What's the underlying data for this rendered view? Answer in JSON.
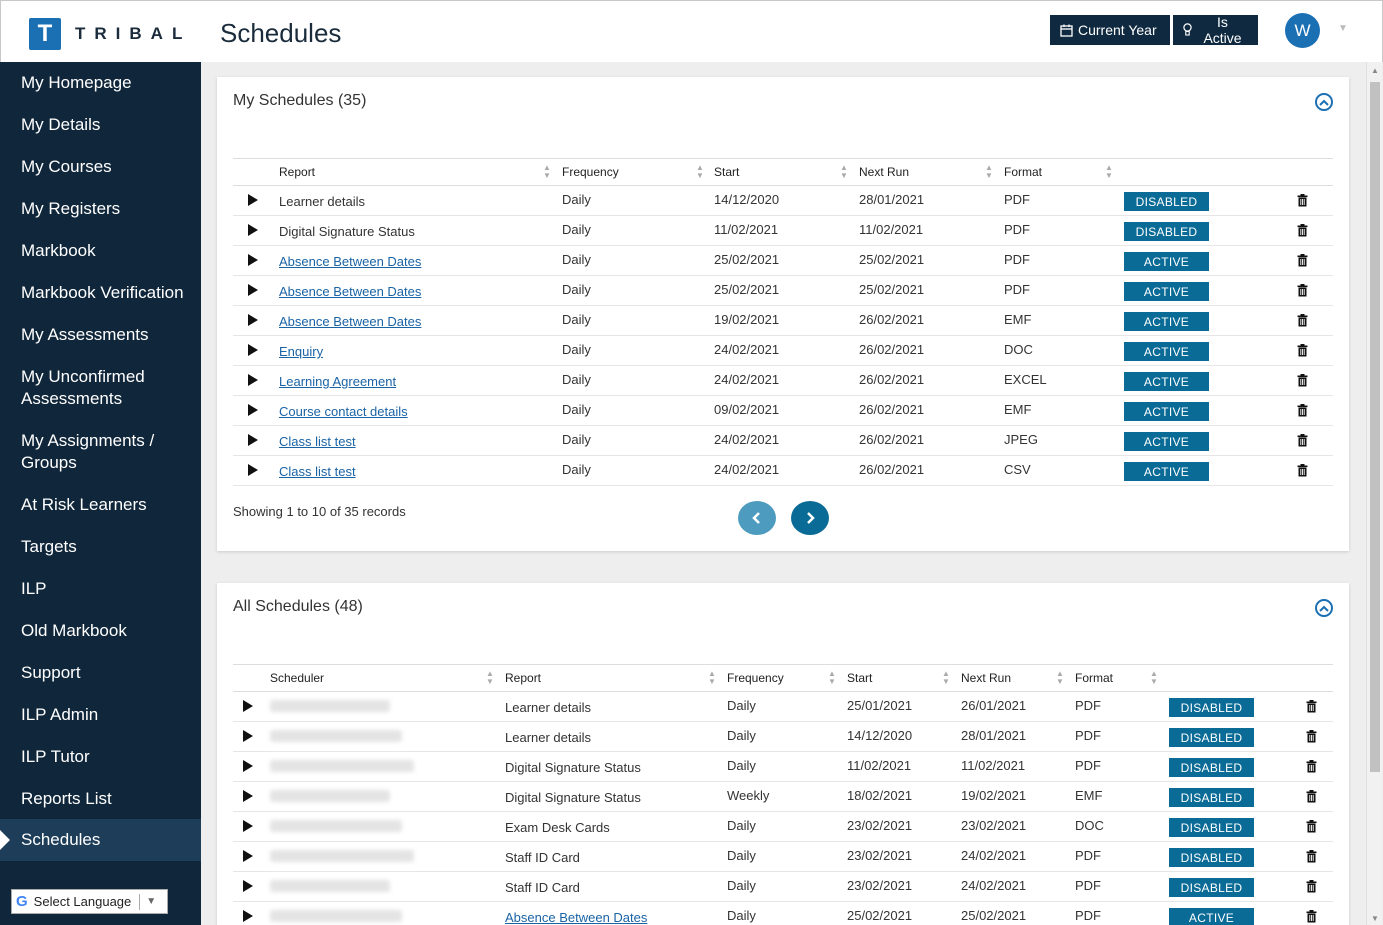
{
  "header": {
    "logo_letter": "T",
    "logo_word": "TRIBAL",
    "page_title": "Schedules",
    "current_year_label": "Current Year",
    "is_active_label": "Is Active",
    "avatar_initial": "W"
  },
  "sidebar": {
    "items": [
      {
        "label": "My Homepage"
      },
      {
        "label": "My Details"
      },
      {
        "label": "My Courses"
      },
      {
        "label": "My Registers"
      },
      {
        "label": "Markbook"
      },
      {
        "label": "Markbook Verification"
      },
      {
        "label": "My Assessments"
      },
      {
        "label": "My Unconfirmed Assessments"
      },
      {
        "label": "My Assignments / Groups"
      },
      {
        "label": "At Risk Learners"
      },
      {
        "label": "Targets"
      },
      {
        "label": "ILP"
      },
      {
        "label": "Old Markbook"
      },
      {
        "label": "Support"
      },
      {
        "label": "ILP Admin"
      },
      {
        "label": "ILP Tutor"
      },
      {
        "label": "Reports List"
      },
      {
        "label": "Schedules",
        "selected": true
      }
    ],
    "language_label": "Select Language"
  },
  "my_schedules": {
    "title": "My Schedules (35)",
    "headers": [
      "Report",
      "Frequency",
      "Start",
      "Next Run",
      "Format"
    ],
    "rows": [
      {
        "report": "Learner details",
        "link": false,
        "frequency": "Daily",
        "start": "14/12/2020",
        "next_run": "28/01/2021",
        "format": "PDF",
        "status": "DISABLED"
      },
      {
        "report": "Digital Signature Status",
        "link": false,
        "frequency": "Daily",
        "start": "11/02/2021",
        "next_run": "11/02/2021",
        "format": "PDF",
        "status": "DISABLED"
      },
      {
        "report": "Absence Between Dates",
        "link": true,
        "frequency": "Daily",
        "start": "25/02/2021",
        "next_run": "25/02/2021",
        "format": "PDF",
        "status": "ACTIVE"
      },
      {
        "report": "Absence Between Dates",
        "link": true,
        "frequency": "Daily",
        "start": "25/02/2021",
        "next_run": "25/02/2021",
        "format": "PDF",
        "status": "ACTIVE"
      },
      {
        "report": "Absence Between Dates",
        "link": true,
        "frequency": "Daily",
        "start": "19/02/2021",
        "next_run": "26/02/2021",
        "format": "EMF",
        "status": "ACTIVE"
      },
      {
        "report": "Enquiry",
        "link": true,
        "frequency": "Daily",
        "start": "24/02/2021",
        "next_run": "26/02/2021",
        "format": "DOC",
        "status": "ACTIVE"
      },
      {
        "report": "Learning Agreement",
        "link": true,
        "frequency": "Daily",
        "start": "24/02/2021",
        "next_run": "26/02/2021",
        "format": "EXCEL",
        "status": "ACTIVE"
      },
      {
        "report": "Course contact details",
        "link": true,
        "frequency": "Daily",
        "start": "09/02/2021",
        "next_run": "26/02/2021",
        "format": "EMF",
        "status": "ACTIVE"
      },
      {
        "report": "Class list test",
        "link": true,
        "frequency": "Daily",
        "start": "24/02/2021",
        "next_run": "26/02/2021",
        "format": "JPEG",
        "status": "ACTIVE"
      },
      {
        "report": "Class list test",
        "link": true,
        "frequency": "Daily",
        "start": "24/02/2021",
        "next_run": "26/02/2021",
        "format": "CSV",
        "status": "ACTIVE"
      }
    ],
    "showing_text": "Showing 1 to 10 of 35 records"
  },
  "all_schedules": {
    "title": "All Schedules (48)",
    "headers": [
      "Scheduler",
      "Report",
      "Frequency",
      "Start",
      "Next Run",
      "Format"
    ],
    "rows": [
      {
        "report": "Learner details",
        "link": false,
        "frequency": "Daily",
        "start": "25/01/2021",
        "next_run": "26/01/2021",
        "format": "PDF",
        "status": "DISABLED"
      },
      {
        "report": "Learner details",
        "link": false,
        "frequency": "Daily",
        "start": "14/12/2020",
        "next_run": "28/01/2021",
        "format": "PDF",
        "status": "DISABLED"
      },
      {
        "report": "Digital Signature Status",
        "link": false,
        "frequency": "Daily",
        "start": "11/02/2021",
        "next_run": "11/02/2021",
        "format": "PDF",
        "status": "DISABLED"
      },
      {
        "report": "Digital Signature Status",
        "link": false,
        "frequency": "Weekly",
        "start": "18/02/2021",
        "next_run": "19/02/2021",
        "format": "EMF",
        "status": "DISABLED"
      },
      {
        "report": "Exam Desk Cards",
        "link": false,
        "frequency": "Daily",
        "start": "23/02/2021",
        "next_run": "23/02/2021",
        "format": "DOC",
        "status": "DISABLED"
      },
      {
        "report": "Staff ID Card",
        "link": false,
        "frequency": "Daily",
        "start": "23/02/2021",
        "next_run": "24/02/2021",
        "format": "PDF",
        "status": "DISABLED"
      },
      {
        "report": "Staff ID Card",
        "link": false,
        "frequency": "Daily",
        "start": "23/02/2021",
        "next_run": "24/02/2021",
        "format": "PDF",
        "status": "DISABLED"
      },
      {
        "report": "Absence Between Dates",
        "link": true,
        "frequency": "Daily",
        "start": "25/02/2021",
        "next_run": "25/02/2021",
        "format": "PDF",
        "status": "ACTIVE"
      }
    ]
  },
  "colors": {
    "sidebar_bg": "#10263a",
    "accent": "#1b6fb3",
    "badge": "#0a6b96",
    "link": "#1a63a5"
  }
}
